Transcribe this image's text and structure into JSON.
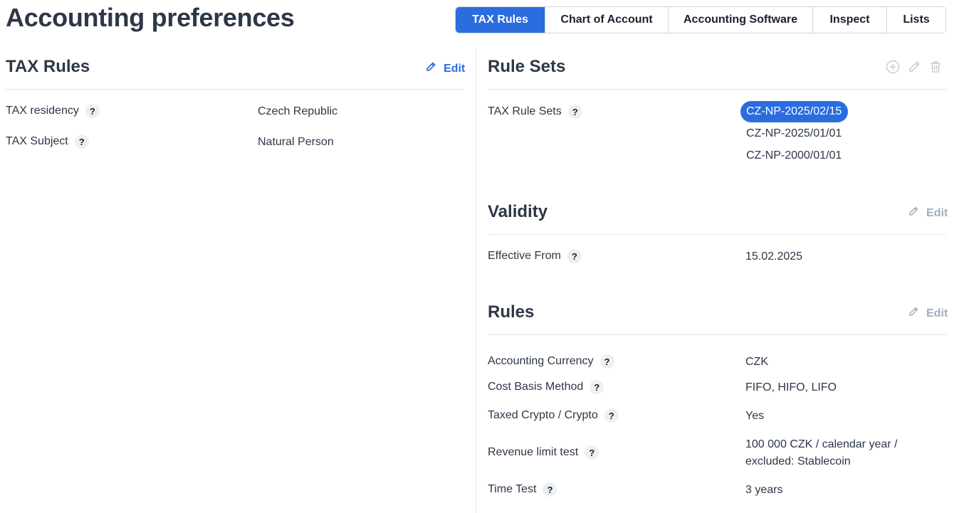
{
  "page": {
    "title": "Accounting preferences"
  },
  "tabs": [
    "TAX Rules",
    "Chart of Account",
    "Accounting Software",
    "Inspect",
    "Lists"
  ],
  "tax_rules": {
    "heading": "TAX Rules",
    "edit_label": "Edit",
    "rows": [
      {
        "label": "TAX residency",
        "value": "Czech Republic"
      },
      {
        "label": "TAX Subject",
        "value": "Natural Person"
      }
    ]
  },
  "rule_sets": {
    "heading": "Rule Sets",
    "label": "TAX Rule Sets",
    "items": [
      "CZ-NP-2025/02/15",
      "CZ-NP-2025/01/01",
      "CZ-NP-2000/01/01"
    ],
    "selected_index": 0
  },
  "validity": {
    "heading": "Validity",
    "edit_label": "Edit",
    "label": "Effective From",
    "value": "15.02.2025"
  },
  "rules": {
    "heading": "Rules",
    "edit_label": "Edit",
    "rows": [
      {
        "label": "Accounting Currency",
        "value": "CZK"
      },
      {
        "label": "Cost Basis Method",
        "value": "FIFO, HIFO, LIFO"
      },
      {
        "label": "Taxed Crypto / Crypto",
        "value": "Yes"
      },
      {
        "label": "Revenue limit test",
        "value_line1": "100 000 CZK / calendar year /",
        "value_line2": "excluded: Stablecoin"
      },
      {
        "label": "Time Test",
        "value": "3 years"
      }
    ]
  },
  "help_glyph": "?",
  "colors": {
    "accent": "#2b6cdf",
    "text": "#2d3748",
    "muted": "#a0aec0",
    "border": "#e2e8f0"
  }
}
